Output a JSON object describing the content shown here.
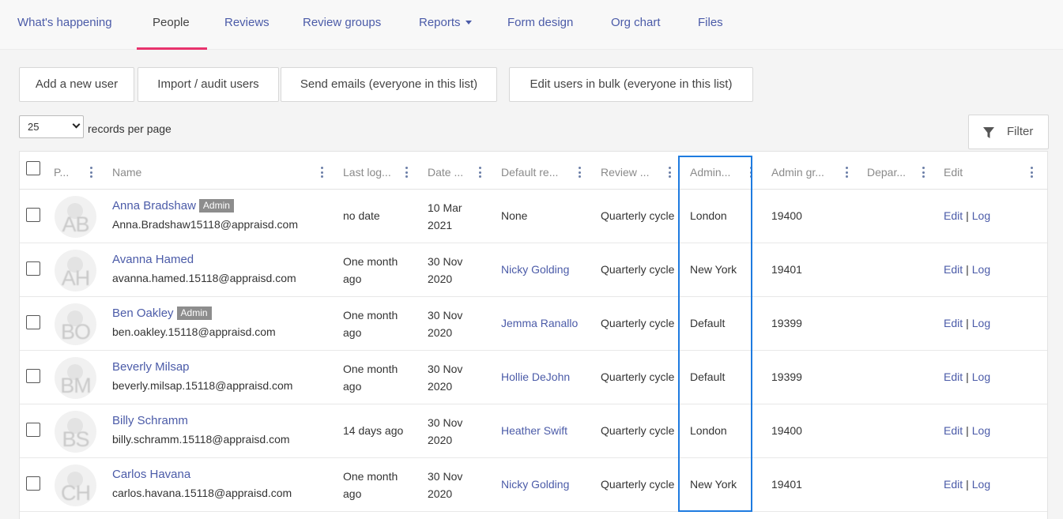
{
  "nav": {
    "tabs": [
      {
        "label": "What's happening"
      },
      {
        "label": "People"
      },
      {
        "label": "Reviews"
      },
      {
        "label": "Review groups"
      },
      {
        "label": "Reports"
      },
      {
        "label": "Form design"
      },
      {
        "label": "Org chart"
      },
      {
        "label": "Files"
      }
    ],
    "active": "People"
  },
  "toolbar": {
    "add_user": "Add a new user",
    "import_audit": "Import / audit users",
    "send_emails": "Send emails (everyone in this list)",
    "edit_bulk": "Edit users in bulk (everyone in this list)"
  },
  "paging": {
    "per_page_value": "25",
    "per_page_label": "records per page"
  },
  "filter": {
    "label": "Filter"
  },
  "table": {
    "headers": {
      "photo": "P...",
      "name": "Name",
      "last_login": "Last log...",
      "date": "Date ...",
      "default_reviewer": "Default re...",
      "review": "Review ...",
      "admin": "Admin...",
      "admin_group": "Admin gr...",
      "department": "Depar...",
      "edit": "Edit"
    },
    "rows": [
      {
        "initials": "AB",
        "name": "Anna Bradshaw",
        "admin_badge": "Admin",
        "email": "Anna.Bradshaw15118@appraisd.com",
        "last_login": [
          "no date"
        ],
        "date": [
          "10 Mar",
          "2021"
        ],
        "default_reviewer": "None",
        "reviewer_is_link": false,
        "review": "Quarterly cycle",
        "admin": "London",
        "admin_group": "19400",
        "edit": "Edit",
        "log": "Log"
      },
      {
        "initials": "AH",
        "name": "Avanna Hamed",
        "admin_badge": "",
        "email": "avanna.hamed.15118@appraisd.com",
        "last_login": [
          "One month",
          "ago"
        ],
        "date": [
          "30 Nov",
          "2020"
        ],
        "default_reviewer": "Nicky Golding",
        "reviewer_is_link": true,
        "review": "Quarterly cycle",
        "admin": "New York",
        "admin_group": "19401",
        "edit": "Edit",
        "log": "Log"
      },
      {
        "initials": "BO",
        "name": "Ben Oakley",
        "admin_badge": "Admin",
        "email": "ben.oakley.15118@appraisd.com",
        "last_login": [
          "One month",
          "ago"
        ],
        "date": [
          "30 Nov",
          "2020"
        ],
        "default_reviewer": "Jemma Ranallo",
        "reviewer_is_link": true,
        "review": "Quarterly cycle",
        "admin": "Default",
        "admin_group": "19399",
        "edit": "Edit",
        "log": "Log"
      },
      {
        "initials": "BM",
        "name": "Beverly Milsap",
        "admin_badge": "",
        "email": "beverly.milsap.15118@appraisd.com",
        "last_login": [
          "One month",
          "ago"
        ],
        "date": [
          "30 Nov",
          "2020"
        ],
        "default_reviewer": "Hollie DeJohn",
        "reviewer_is_link": true,
        "review": "Quarterly cycle",
        "admin": "Default",
        "admin_group": "19399",
        "edit": "Edit",
        "log": "Log"
      },
      {
        "initials": "BS",
        "name": "Billy Schramm",
        "admin_badge": "",
        "email": "billy.schramm.15118@appraisd.com",
        "last_login": [
          "14 days ago"
        ],
        "date": [
          "30 Nov",
          "2020"
        ],
        "default_reviewer": "Heather Swift",
        "reviewer_is_link": true,
        "review": "Quarterly cycle",
        "admin": "London",
        "admin_group": "19400",
        "edit": "Edit",
        "log": "Log"
      },
      {
        "initials": "CH",
        "name": "Carlos Havana",
        "admin_badge": "",
        "email": "carlos.havana.15118@appraisd.com",
        "last_login": [
          "One month",
          "ago"
        ],
        "date": [
          "30 Nov",
          "2020"
        ],
        "default_reviewer": "Nicky Golding",
        "reviewer_is_link": true,
        "review": "Quarterly cycle",
        "admin": "New York",
        "admin_group": "19401",
        "edit": "Edit",
        "log": "Log"
      }
    ]
  },
  "colors": {
    "link": "#4b5ba8",
    "active_underline": "#e8336d",
    "highlight_border": "#1e7be0"
  }
}
